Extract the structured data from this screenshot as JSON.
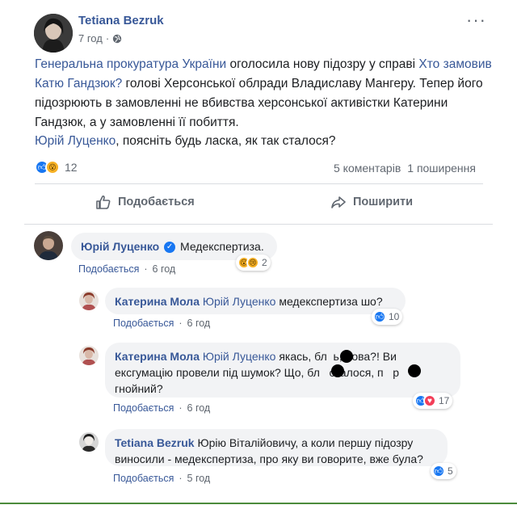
{
  "post": {
    "author": "Tetiana Bezruk",
    "time": "7 год",
    "privacy_icon": "globe-icon",
    "body": {
      "link1": "Генеральна прокуратура України",
      "text1": " оголосила нову підозру у справі ",
      "link2": "Хто замовив Катю Гандзюк?",
      "text2": " голові Херсонської облради Владиславу Мангеру. Тепер його підозрюють в замовленні не вбивства херсонської активістки Катерини Гандзюк, а у замовленні її побиття."
    },
    "question": {
      "mention": "Юрій Луценко",
      "text": ", поясніть будь ласка, як так сталося?"
    },
    "reactions": {
      "icons": [
        "like",
        "wow"
      ],
      "count": "12"
    },
    "stats": {
      "comments": "5 коментарів",
      "shares": "1 поширення"
    },
    "actions": {
      "like": "Подобається",
      "share": "Поширити"
    }
  },
  "comments": [
    {
      "author": "Юрій Луценко",
      "verified": true,
      "text": "Медекспертиза.",
      "like_label": "Подобається",
      "time": "6 год",
      "reactions": {
        "icons": [
          "wow",
          "sad"
        ],
        "count": "2"
      }
    },
    {
      "author": "Катерина Мола",
      "mention": "Юрій Луценко",
      "text": "медекспертиза шо?",
      "like_label": "Подобається",
      "time": "6 год",
      "reactions": {
        "icons": [
          "like"
        ],
        "count": "10"
      }
    },
    {
      "author": "Катерина Мола",
      "mention": "Юрій Луценко",
      "text": "якась, бл..ь, нова?! Ви ексгумацію провели під шумок? Що, бл..ь сталося, п..р гнойний?",
      "line1": "якась, бл  ь, нова?! Ви",
      "line2": "ексгумацію провели під шумок? Що, бл   сталося, п   р",
      "line3": "гнойний?",
      "like_label": "Подобається",
      "time": "6 год",
      "reactions": {
        "icons": [
          "like",
          "love"
        ],
        "count": "17"
      }
    },
    {
      "author": "Tetiana Bezruk",
      "line1": "Юрію Віталійовичу, а коли першу підозру",
      "line2": "виносили - медекспертиза, про яку ви говорите, вже була?",
      "like_label": "Подобається",
      "time": "5 год",
      "reactions": {
        "icons": [
          "like"
        ],
        "count": "5"
      }
    }
  ],
  "colors": {
    "link": "#385898",
    "like": "#1877f2",
    "love": "#f33e58",
    "wow": "#f7b125"
  }
}
